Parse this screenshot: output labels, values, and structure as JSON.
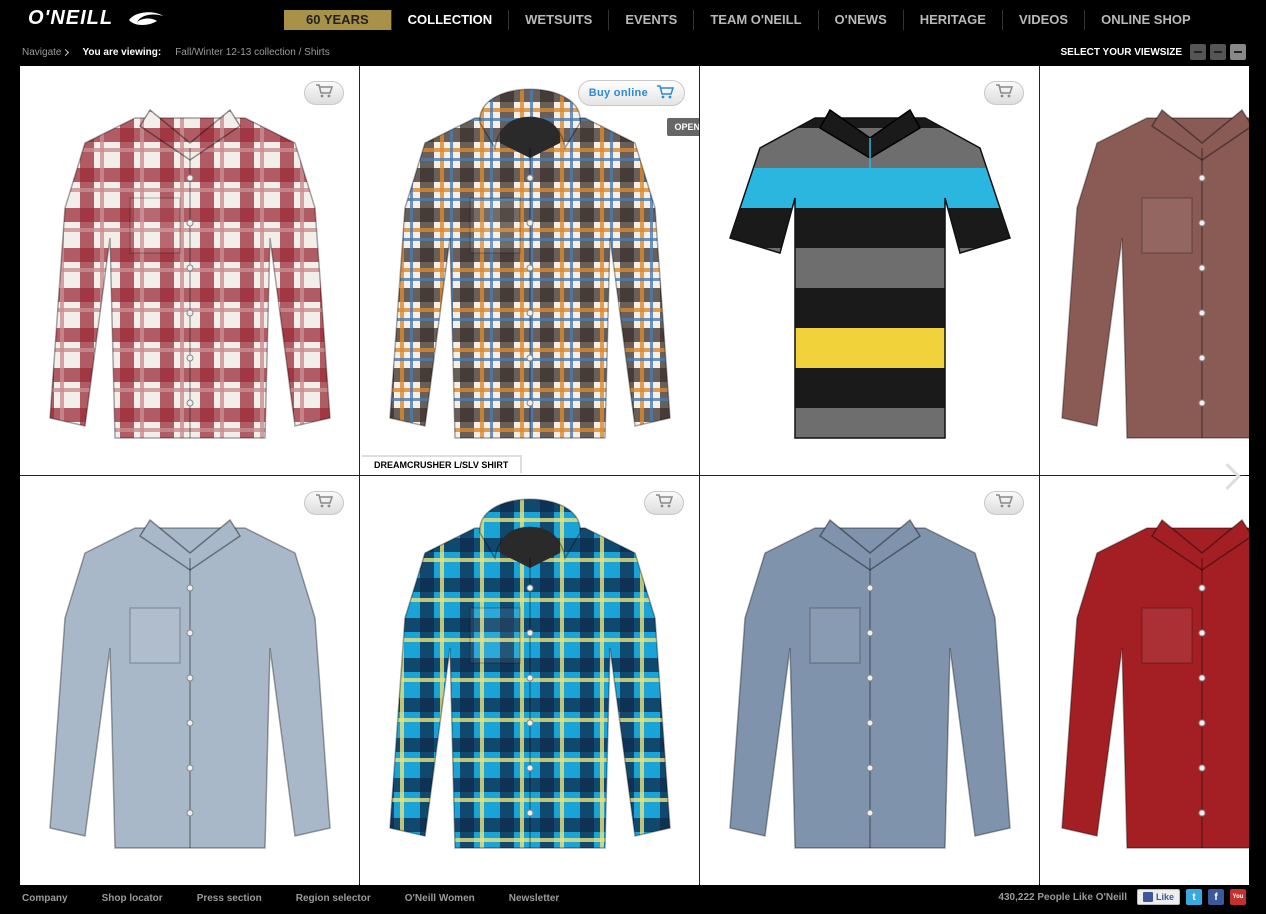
{
  "header": {
    "logo_text": "O'NEILL",
    "nav": [
      {
        "label": "60 YEARS",
        "kind": "years"
      },
      {
        "label": "COLLECTION",
        "kind": "active"
      },
      {
        "label": "WETSUITS",
        "kind": ""
      },
      {
        "label": "EVENTS",
        "kind": ""
      },
      {
        "label": "TEAM O'NEILL",
        "kind": ""
      },
      {
        "label": "O'NEWS",
        "kind": ""
      },
      {
        "label": "HERITAGE",
        "kind": ""
      },
      {
        "label": "VIDEOS",
        "kind": ""
      },
      {
        "label": "ONLINE SHOP",
        "kind": ""
      }
    ]
  },
  "subbar": {
    "navigate_label": "Navigate",
    "viewing_label": "You are viewing:",
    "path": "Fall/Winter 12-13 collection / Shirts",
    "viewsize_label": "SELECT YOUR VIEWSIZE"
  },
  "products": [
    {
      "id": "p1",
      "pattern": "red-plaid",
      "hood": false
    },
    {
      "id": "p2",
      "pattern": "multi-plaid",
      "hood": true,
      "buy_label": "Buy online",
      "open_label": "OPEN",
      "name": "DREAMCRUSHER L/SLV SHIRT"
    },
    {
      "id": "p3",
      "pattern": "striped-polo",
      "hood": false
    },
    {
      "id": "p4",
      "pattern": "maroon-solid",
      "hood": false
    },
    {
      "id": "p5",
      "pattern": "light-chambray",
      "hood": false
    },
    {
      "id": "p6",
      "pattern": "blue-plaid",
      "hood": true
    },
    {
      "id": "p7",
      "pattern": "chambray",
      "hood": false
    },
    {
      "id": "p8",
      "pattern": "red-solid",
      "hood": false
    }
  ],
  "footer": {
    "links": [
      "Company",
      "Shop locator",
      "Press section",
      "Region selector",
      "O'Neill Women",
      "Newsletter"
    ],
    "likes_text": "430,222 People Like O'Neill",
    "like_button": "Like",
    "twitter_glyph": "t",
    "facebook_glyph": "f",
    "youtube_glyph": "You"
  },
  "colors": {
    "accent_gold": "#a8924a",
    "buy_blue": "#2a8ad8"
  }
}
